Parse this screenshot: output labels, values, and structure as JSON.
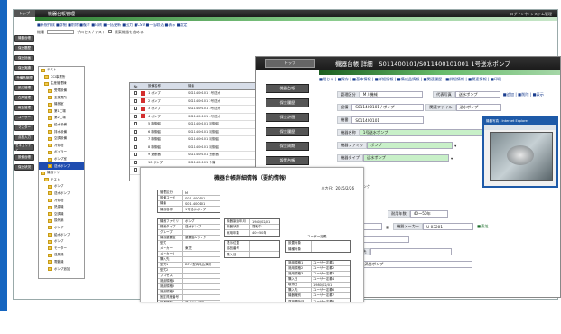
{
  "w1": {
    "app": "トップ",
    "title": "機器台帳管理",
    "user": "ログイン中: システム管理",
    "actions": "■新規作成 ■詳細 ■削除 ■複写 ■印刷 ■一括更新 ■出力 ■CSV ■一括取込 ■表示 ■設定",
    "search_label": "機種",
    "search_text": "プロセス / テスト",
    "check_label": "廃棄機器を含める",
    "side": [
      "機器台帳",
      "保全履歴",
      "保全計画",
      "保全実績",
      "予備品管理",
      "設定管理",
      "在庫管理",
      "報告管理",
      "ユーザー",
      "マスター",
      "点検入力",
      "セキュリティ",
      "設備台帳",
      "保全状況"
    ],
    "tree": [
      {
        "label": "テスト",
        "sel": false
      },
      {
        "label": "CCI事業所",
        "sel": false
      },
      {
        "label": "生産管理棟",
        "sel": false
      },
      {
        "label": "受電設備",
        "sel": false
      },
      {
        "label": "主変電所",
        "sel": false
      },
      {
        "label": "機械室",
        "sel": false
      },
      {
        "label": "第1工場",
        "sel": false
      },
      {
        "label": "第2工場",
        "sel": false
      },
      {
        "label": "給水設備",
        "sel": false
      },
      {
        "label": "排水設備",
        "sel": false
      },
      {
        "label": "空調設備",
        "sel": false
      },
      {
        "label": "冷却塔",
        "sel": false
      },
      {
        "label": "ボイラー",
        "sel": false
      },
      {
        "label": "ポンプ室",
        "sel": false
      },
      {
        "label": "送水ポンプ",
        "sel": true
      },
      {
        "label": "機器ツリー",
        "sel": false
      },
      {
        "label": "テスト",
        "sel": false
      },
      {
        "label": "ポンプ",
        "sel": false
      },
      {
        "label": "送水ポンプ",
        "sel": false
      },
      {
        "label": "冷却塔",
        "sel": false
      },
      {
        "label": "熱源機",
        "sel": false
      },
      {
        "label": "空調機",
        "sel": false
      },
      {
        "label": "換気扇",
        "sel": false
      },
      {
        "label": "ポンプ",
        "sel": false
      },
      {
        "label": "給水ポンプ",
        "sel": false
      },
      {
        "label": "ポンプ",
        "sel": false
      },
      {
        "label": "モーター",
        "sel": false
      },
      {
        "label": "送風機",
        "sel": false
      },
      {
        "label": "電動機",
        "sel": false
      },
      {
        "label": "ポンプ追加",
        "sel": false
      }
    ],
    "grid_headers": [
      "No",
      "設備名称",
      "機番"
    ],
    "grid_rows": [
      {
        "n": "1",
        "name": "ポンプ",
        "code": "S011400101 1号送水"
      },
      {
        "n": "2",
        "name": "ポンプ",
        "code": "S011400101 2号送水"
      },
      {
        "n": "3",
        "name": "ポンプ",
        "code": "S011400101 3号送水"
      },
      {
        "n": "4",
        "name": "ポンプ",
        "code": "S011400101 4号送水"
      },
      {
        "n": "5",
        "name": "制御盤",
        "code": "S011400101 制御盤"
      },
      {
        "n": "6",
        "name": "制御盤",
        "code": "S011400101 制御盤"
      },
      {
        "n": "7",
        "name": "制御盤",
        "code": "S011400101 制御盤"
      },
      {
        "n": "8",
        "name": "制御盤",
        "code": "S011400101 制御盤"
      },
      {
        "n": "9",
        "name": "遮断器",
        "code": "S011400101 遮断器"
      },
      {
        "n": "10",
        "name": "ポンプ",
        "code": "S011400101 予備"
      },
      {
        "n": "11",
        "name": "ポンプ",
        "code": "S011400101 予備"
      }
    ]
  },
  "w2": {
    "top_button": "トップ",
    "title": "機器台帳 詳細　S011400101/S011400101001 1号送水ポンプ",
    "tabs": "■閉じる | ■保存 | ■基本情報 | ■詳細情報 | ■構成品情報 | ■関連履歴 | ■詳細情報 | ■関連情報 | ■印刷",
    "side": [
      "機器台帳",
      "保全履歴",
      "保全計画",
      "保全履歴",
      "保全周期",
      "設置台帳",
      "在庫管理"
    ],
    "fields": {
      "kanri_label": "管理区分",
      "kanri": "M / 機械",
      "photo_label": "代表写真",
      "photo": "送水ポンプ",
      "photo_links": "■追加 | ■削除 | ■表示",
      "setsubi_label": "設備",
      "setsubi": "S011400101 / ポンプ",
      "related_label": "関連ファイル",
      "related": "送水ポンプ",
      "kiban_label": "機番",
      "kiban": "S011400101",
      "name_label": "機器名称",
      "name": "1号送水ポンプ",
      "family_label": "機器ファミリ",
      "family": "ポンプ",
      "type_label": "機器タイプ",
      "type": "送水ポンプ",
      "rank": "重要度Aランク",
      "cycle_label": "0 / 運転中",
      "cycle_val": "耐用年数",
      "cycle_range": "40〜50年",
      "date": "1980-02-01",
      "maker_label": "機器メーカー",
      "maker": "U-03201",
      "maker_link": "■東芝",
      "spare": "送水ポンプ室",
      "purchase_label": "購入先",
      "model": "DF-1型両吸込渦巻ポンプ"
    },
    "popup_title": "機器写真 - Internet Explorer"
  },
  "w3": {
    "title": "機器台帳詳細情報（要約情報）",
    "date": "出力日：2015/2/26",
    "info": [
      {
        "k": "管理区分",
        "v": "M"
      },
      {
        "k": "設備コード",
        "v": "S011400101"
      },
      {
        "k": "機番",
        "v": "S011400101"
      },
      {
        "k": "機器名称",
        "v": "1号送水ポンプ"
      }
    ],
    "left": [
      {
        "k": "機器ファミリ",
        "v": "ポンプ"
      },
      {
        "k": "機器タイプ",
        "v": "送水ポンプ"
      },
      {
        "k": "グループ",
        "v": ""
      },
      {
        "k": "機器重要度",
        "v": "重要度Aランク"
      },
      {
        "k": "型式",
        "v": ""
      },
      {
        "k": "メーカー",
        "v": "東芝"
      },
      {
        "k": "メーカー2",
        "v": ""
      },
      {
        "k": "購入先",
        "v": ""
      },
      {
        "k": "型式1",
        "v": "DF-1型両吸込渦巻"
      },
      {
        "k": "型式2",
        "v": ""
      },
      {
        "k": "プロセス",
        "v": ""
      },
      {
        "k": "適用規格1",
        "v": ""
      },
      {
        "k": "適用規格2",
        "v": ""
      },
      {
        "k": "適用規格3",
        "v": ""
      },
      {
        "k": "固定資産番号",
        "v": ""
      },
      {
        "k": "設置場所",
        "v": "送水ポンプ室"
      },
      {
        "k": "取得価格",
        "v": ""
      }
    ],
    "mid": [
      {
        "k": "機器製造年月",
        "v": "1980/02/01"
      },
      {
        "k": "機器状態",
        "v": "運転中"
      },
      {
        "k": "耐用年数",
        "v": "40〜50年"
      }
    ],
    "mid2": [
      {
        "k": "表示位置",
        "v": ""
      },
      {
        "k": "部品番号",
        "v": ""
      },
      {
        "k": "購入日",
        "v": ""
      }
    ],
    "right_head": "ユーザー定義",
    "right": [
      {
        "k": "設置対象",
        "v": ""
      },
      {
        "k": "機種対象",
        "v": ""
      }
    ],
    "right2": [
      {
        "k": "適用規格1",
        "v": "ユーザー定義1"
      },
      {
        "k": "適用規格2",
        "v": "ユーザー定義2"
      },
      {
        "k": "適用規格3",
        "v": "ユーザー定義3"
      },
      {
        "k": "購入日",
        "v": "ユーザー定義4"
      },
      {
        "k": "取得日",
        "v": "1980/02/01"
      },
      {
        "k": "購入先",
        "v": "ユーザー定義6"
      },
      {
        "k": "機器識別",
        "v": "ユーザー定義7"
      },
      {
        "k": "運用開始日",
        "v": "ユーザー定義8"
      }
    ]
  }
}
